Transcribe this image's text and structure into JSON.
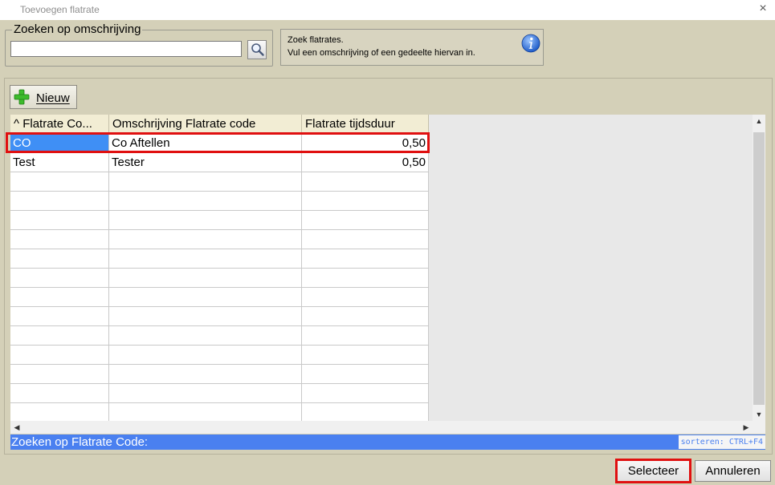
{
  "window": {
    "title": "Toevoegen flatrate",
    "close_glyph": "×"
  },
  "search": {
    "legend": "Zoeken op omschrijving",
    "value": "",
    "button_icon": "search-icon"
  },
  "info": {
    "line1": "Zoek flatrates.",
    "line2": "Vul een omschrijving of een gedeelte hiervan in.",
    "icon": "info-icon"
  },
  "toolbar": {
    "new_label": "Nieuw",
    "new_icon": "plus-icon"
  },
  "table": {
    "columns": [
      "^ Flatrate Co...",
      "Omschrijving Flatrate code",
      "Flatrate tijdsduur"
    ],
    "rows": [
      {
        "code": "CO",
        "description": "Co Aftellen",
        "duration": "0,50",
        "selected": true
      },
      {
        "code": "Test",
        "description": "Tester",
        "duration": "0,50",
        "selected": false
      }
    ],
    "empty_rows": 13
  },
  "status": {
    "search_label": "Zoeken op Flatrate Code:",
    "sort_hint": "sorteren: CTRL+F4"
  },
  "buttons": {
    "select": "Selecteer",
    "cancel": "Annuleren"
  },
  "colors": {
    "selection": "#3f8ff5",
    "status_bar": "#4a80f0",
    "highlight": "#e01010"
  }
}
